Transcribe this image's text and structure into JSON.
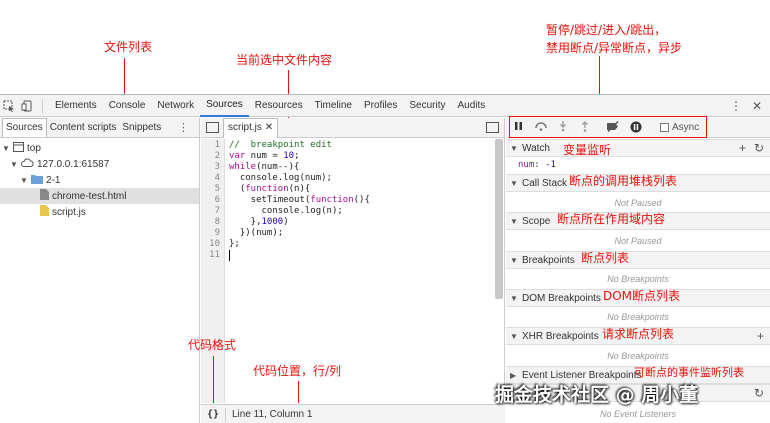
{
  "annotations": {
    "file_list": "文件列表",
    "current_file": "当前选中文件内容",
    "controls_line1": "暂停/跳过/进入/跳出，",
    "controls_line2": "禁用断点/异常断点，异步",
    "watch": "变量监听",
    "call_stack": "断点的调用堆栈列表",
    "scope": "断点所在作用域内容",
    "breakpoints": "断点列表",
    "dom_breakpoints": "DOM断点列表",
    "xhr_breakpoints": "请求断点列表",
    "event_listeners": "可断点的事件监听列表",
    "code_format": "代码格式",
    "code_position": "代码位置，行/列"
  },
  "toolbar": {
    "tabs": [
      "Elements",
      "Console",
      "Network",
      "Sources",
      "Resources",
      "Timeline",
      "Profiles",
      "Security",
      "Audits"
    ],
    "active_tab": "Sources"
  },
  "navigator": {
    "tabs": [
      "Sources",
      "Content scripts",
      "Snippets"
    ],
    "tree": {
      "top": "top",
      "host": "127.0.0.1:61587",
      "folder": "2-1",
      "files": [
        "chrome-test.html",
        "script.js"
      ]
    }
  },
  "editor": {
    "file_tab": "script.js",
    "line_numbers": [
      "1",
      "2",
      "3",
      "4",
      "5",
      "6",
      "7",
      "8",
      "9",
      "10",
      "11"
    ],
    "status": "Line 11, Column 1",
    "format_button": "{}"
  },
  "sidebar": {
    "async_label": "Async",
    "watch": {
      "title": "Watch",
      "expr": "num",
      "value": "-1"
    },
    "call_stack": {
      "title": "Call Stack",
      "body": "Not Paused"
    },
    "scope": {
      "title": "Scope",
      "body": "Not Paused"
    },
    "breakpoints": {
      "title": "Breakpoints",
      "body": "No Breakpoints"
    },
    "dom_breakpoints": {
      "title": "DOM Breakpoints",
      "body": "No Breakpoints"
    },
    "xhr_breakpoints": {
      "title": "XHR Breakpoints",
      "body": "No Breakpoints"
    },
    "event_listener_breakpoints": {
      "title": "Event Listener Breakpoints",
      "body": "No Event Listeners"
    }
  },
  "watermark": "掘金技术社区 @ 周小董",
  "colors": {
    "annotation": "#e8130c",
    "accent": "#3879d9",
    "folder": "#6a9fd8",
    "js_file": "#e8c64d"
  }
}
